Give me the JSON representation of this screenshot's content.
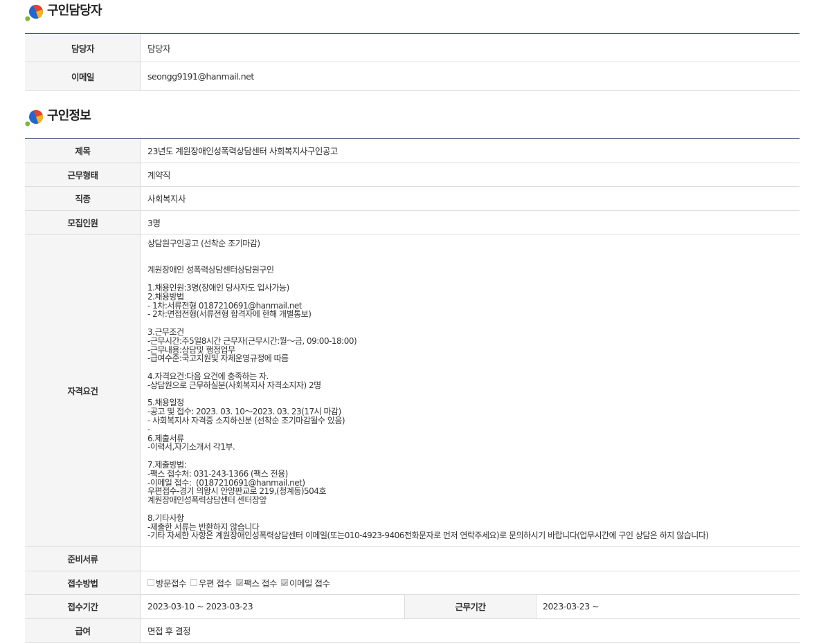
{
  "colors": {
    "table_top_border": "#3f5275",
    "label_background": "#f5f5f5",
    "row_border": "#dcdcdc",
    "text": "#333333"
  },
  "contact_section": {
    "icon": "section-bullet-icon",
    "title": "구인담당자",
    "rows": [
      {
        "label": "담당자",
        "value": "담당자"
      },
      {
        "label": "이메일",
        "value": "seongg9191@hanmail.net"
      }
    ]
  },
  "job_section": {
    "icon": "section-bullet-icon",
    "title": "구인정보",
    "rows": [
      {
        "label": "제목",
        "value": "23년도 계원장애인성폭력상담센터 사회복지사구인공고"
      },
      {
        "label": "근무형태",
        "value": "계약직"
      },
      {
        "label": "직종",
        "value": "사회복지사"
      },
      {
        "label": "모집인원",
        "value": "3명"
      }
    ],
    "requirements": {
      "label": "자격요건",
      "value": "상담원구인공고 (선착순 조기마감)\n\n\n계원장애인 성폭력상담센터상담원구인\n\n1.채용인원:3명(장애인 당사자도 입사가능)\n2.채용방법\n- 1차:서류전형 0187210691@hanmail.net\n- 2차:면접전형(서류전형 합격자에 한해 개별통보)\n\n3.근무조건\n-근무시간:주5일8시간 근무자(근무시간:월～금, 09:00-18:00)\n-근무내용:상담및 행정업무\n-급여수준:국고지원및 자체운영규정에 따름\n\n4.자격요건:다음 요건에 충족하는 자.\n-상담원으로 근무하실분(사회복지사 자격소지자) 2명\n\n5.채용일정\n-공고 및 접수: 2023. 03. 10～2023. 03. 23(17시 마감)\n- 사회복지사 자격증 소지하신분 (선착순 조기마감될수 있음)\n-\n6.제출서류\n-이력서,자기소개서 각1부.\n\n7.제출방법:\n-팩스 접수처: 031-243-1366 (팩스 전용)\n-이메일 접수:  (0187210691@hanmail.net)\n우편접수-경기 의왕시 안양판교로 219,(청계동)504호\n계원장애인성폭력상담센터 센터장앞\n\n8.기타사항\n-제출한 서류는 반환하지 않습니다\n-기타 자세한 사항은 계원장애인성폭력상담센터 이메일(또는010-4923-9406전화문자로 먼저 연락주세요)로 문의하시기 바랍니다(업무시간에 구인 상담은 하지 않습니다)"
    },
    "documents": {
      "label": "준비서류",
      "value": ""
    },
    "apply_method": {
      "label": "접수방법",
      "options": [
        {
          "label": "방문접수",
          "checked": false
        },
        {
          "label": "우편 접수",
          "checked": false
        },
        {
          "label": "팩스 접수",
          "checked": true
        },
        {
          "label": "이메일 접수",
          "checked": true
        }
      ]
    },
    "period": {
      "apply_label": "접수기간",
      "apply_value": "2023-03-10 ~ 2023-03-23",
      "work_label": "근무기간",
      "work_value": "2023-03-23 ~"
    },
    "salary": {
      "label": "급여",
      "value": "면접 후 결정"
    }
  }
}
